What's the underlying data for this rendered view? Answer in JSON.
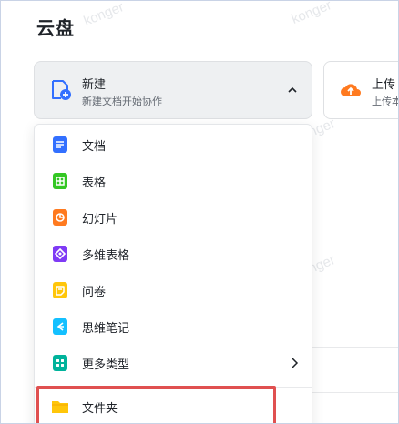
{
  "page": {
    "title": "云盘"
  },
  "watermark": "konger",
  "cards": {
    "new": {
      "title": "新建",
      "subtitle": "新建文档开始协作"
    },
    "upload": {
      "title": "上传",
      "subtitle": "上传本地文件"
    }
  },
  "menu": {
    "items": [
      {
        "label": "文档",
        "icon": "doc-icon",
        "color": "#3370ff"
      },
      {
        "label": "表格",
        "icon": "sheet-icon",
        "color": "#34c724"
      },
      {
        "label": "幻灯片",
        "icon": "slides-icon",
        "color": "#ff7a1f"
      },
      {
        "label": "多维表格",
        "icon": "bitable-icon",
        "color": "#7f3bf5"
      },
      {
        "label": "问卷",
        "icon": "form-icon",
        "color": "#ffc60a"
      },
      {
        "label": "思维笔记",
        "icon": "mindnote-icon",
        "color": "#14c0ff"
      },
      {
        "label": "更多类型",
        "icon": "more-types-icon",
        "color": "#00b39b"
      },
      {
        "label": "文件夹",
        "icon": "folder-icon",
        "color": "#ffc60a"
      }
    ]
  },
  "colors": {
    "highlight": "#e05050",
    "accent": "#3370ff"
  }
}
